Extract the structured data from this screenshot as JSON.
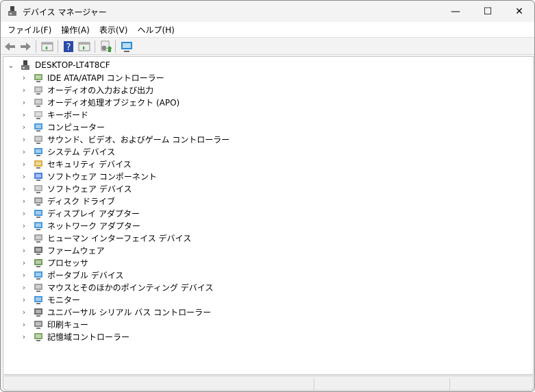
{
  "window": {
    "title": "デバイス マネージャー",
    "minimize": "—",
    "maximize": "☐",
    "close": "✕"
  },
  "menu": [
    "ファイル(F)",
    "操作(A)",
    "表示(V)",
    "ヘルプ(H)"
  ],
  "toolbar": [
    "back-icon",
    "forward-icon",
    "properties-view-icon",
    "help-icon",
    "action-pane-icon",
    "update-driver-icon",
    "scan-hardware-icon"
  ],
  "tree": {
    "root": "DESKTOP-LT4T8CF",
    "items": [
      {
        "label": "IDE ATA/ATAPI コントローラー",
        "icon": "ide-controller-icon",
        "color": "#6a9a4a"
      },
      {
        "label": "オーディオの入力および出力",
        "icon": "speaker-icon",
        "color": "#9a9a9a"
      },
      {
        "label": "オーディオ処理オブジェクト (APO)",
        "icon": "speaker-icon",
        "color": "#9a9a9a"
      },
      {
        "label": "キーボード",
        "icon": "keyboard-icon",
        "color": "#b0b0b0"
      },
      {
        "label": "コンピューター",
        "icon": "computer-icon",
        "color": "#2a8ad8"
      },
      {
        "label": "サウンド、ビデオ、およびゲーム コントローラー",
        "icon": "speaker-icon",
        "color": "#9a9a9a"
      },
      {
        "label": "システム デバイス",
        "icon": "system-device-icon",
        "color": "#2a8ad8"
      },
      {
        "label": "セキュリティ デバイス",
        "icon": "security-key-icon",
        "color": "#d4a020"
      },
      {
        "label": "ソフトウェア コンポーネント",
        "icon": "software-component-icon",
        "color": "#2a6ad8"
      },
      {
        "label": "ソフトウェア デバイス",
        "icon": "software-device-icon",
        "color": "#a0a0a0"
      },
      {
        "label": "ディスク ドライブ",
        "icon": "disk-drive-icon",
        "color": "#808080"
      },
      {
        "label": "ディスプレイ アダプター",
        "icon": "display-adapter-icon",
        "color": "#2a8ad8"
      },
      {
        "label": "ネットワーク アダプター",
        "icon": "network-adapter-icon",
        "color": "#2a8ad8"
      },
      {
        "label": "ヒューマン インターフェイス デバイス",
        "icon": "hid-icon",
        "color": "#909090"
      },
      {
        "label": "ファームウェア",
        "icon": "firmware-icon",
        "color": "#505050"
      },
      {
        "label": "プロセッサ",
        "icon": "processor-icon",
        "color": "#5a8a3a"
      },
      {
        "label": "ポータブル デバイス",
        "icon": "portable-device-icon",
        "color": "#2a8ad8"
      },
      {
        "label": "マウスとそのほかのポインティング デバイス",
        "icon": "mouse-icon",
        "color": "#909090"
      },
      {
        "label": "モニター",
        "icon": "monitor-icon",
        "color": "#2a8ad8"
      },
      {
        "label": "ユニバーサル シリアル バス コントローラー",
        "icon": "usb-icon",
        "color": "#505050"
      },
      {
        "label": "印刷キュー",
        "icon": "printer-icon",
        "color": "#707070"
      },
      {
        "label": "記憶域コントローラー",
        "icon": "storage-controller-icon",
        "color": "#6a9a4a"
      }
    ]
  }
}
